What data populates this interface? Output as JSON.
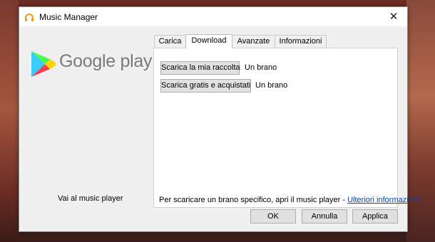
{
  "window": {
    "title": "Music Manager",
    "close_glyph": "✕"
  },
  "brand": {
    "name": "Google play",
    "logo_icon": "google-play-triangle-icon"
  },
  "sidebar": {
    "music_player_link": "Vai al music player"
  },
  "tabs": [
    {
      "label": "Carica",
      "active": false
    },
    {
      "label": "Download",
      "active": true
    },
    {
      "label": "Avanzate",
      "active": false
    },
    {
      "label": "Informazioni",
      "active": false
    }
  ],
  "download": {
    "rows": [
      {
        "button": "Scarica la mia raccolta",
        "value": "Un brano"
      },
      {
        "button": "Scarica gratis e acquistati",
        "value": "Un brano"
      }
    ],
    "hint_text": "Per scaricare un brano specifico, apri il music player - ",
    "hint_link": "Ulteriori informazioni"
  },
  "footer": {
    "ok": "OK",
    "cancel": "Annulla",
    "apply": "Applica"
  },
  "colors": {
    "link": "#0645ad",
    "headphones": "#f29b1d"
  }
}
